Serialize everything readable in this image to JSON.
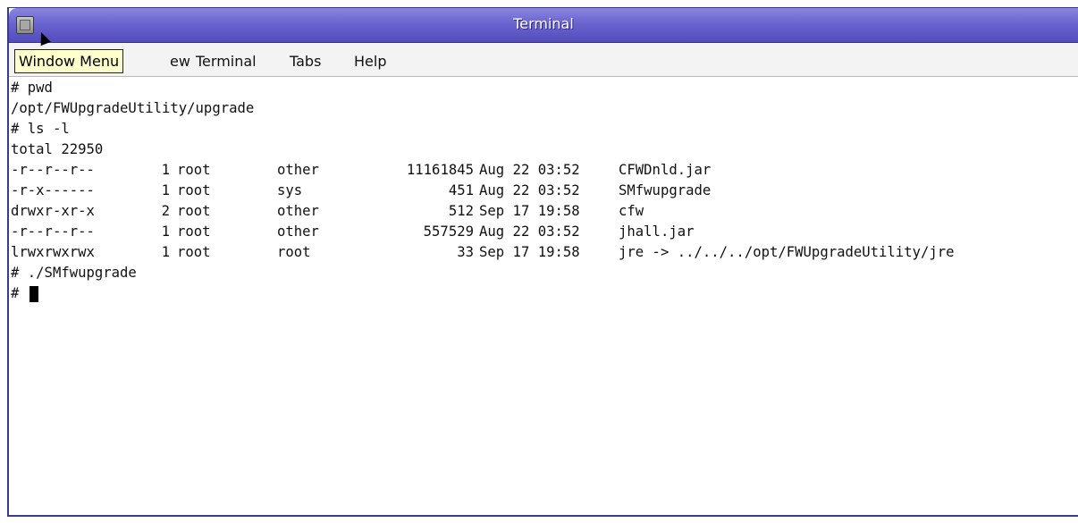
{
  "window": {
    "title": "Terminal"
  },
  "tooltip": {
    "text": "Window Menu"
  },
  "menubar": {
    "view_partial": "ew",
    "terminal": "Terminal",
    "tabs": "Tabs",
    "help": "Help"
  },
  "terminal": {
    "lines": {
      "l0": "# pwd",
      "l1": "/opt/FWUpgradeUtility/upgrade",
      "l2": "# ls -l",
      "l3": "total 22950",
      "l10": "# ./SMfwupgrade",
      "prompt": "#"
    },
    "listing": [
      {
        "perm": "-r--r--r--",
        "links": "1",
        "owner": "root",
        "group": "other",
        "size": "11161845",
        "date": "Aug 22 03:52",
        "name": "CFWDnld.jar"
      },
      {
        "perm": "-r-x------",
        "links": "1",
        "owner": "root",
        "group": "sys",
        "size": "451",
        "date": "Aug 22 03:52",
        "name": "SMfwupgrade"
      },
      {
        "perm": "drwxr-xr-x",
        "links": "2",
        "owner": "root",
        "group": "other",
        "size": "512",
        "date": "Sep 17 19:58",
        "name": "cfw"
      },
      {
        "perm": "-r--r--r--",
        "links": "1",
        "owner": "root",
        "group": "other",
        "size": "557529",
        "date": "Aug 22 03:52",
        "name": "jhall.jar"
      },
      {
        "perm": "lrwxrwxrwx",
        "links": "1",
        "owner": "root",
        "group": "root",
        "size": "33",
        "date": "Sep 17 19:58",
        "name": "jre -> ../../../opt/FWUpgradeUtility/jre"
      }
    ]
  },
  "colors": {
    "titlebar": "#6a64cf",
    "tooltip_bg": "#ffffcc",
    "terminal_bg": "#ffffff"
  },
  "icons": {
    "window_menu": "window-menu-icon",
    "pointer": "mouse-pointer-icon"
  }
}
